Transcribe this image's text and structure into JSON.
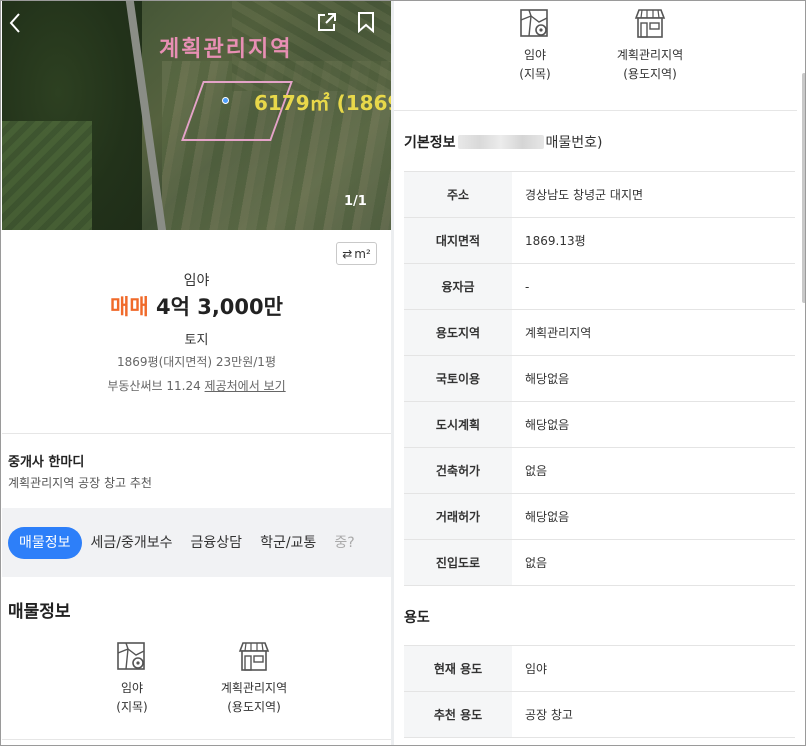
{
  "photo": {
    "zone_overlay": "계획관리지역",
    "area_overlay": "6179㎡ (1869",
    "counter": "1/1"
  },
  "summary": {
    "unit_toggle": "m²",
    "property_type": "임야",
    "deal_type": "매매",
    "price": "4억 3,000만",
    "category": "토지",
    "area_price": "1869평(대지면적)  23만원/1평",
    "source_prefix": "부동산써브 11.24",
    "source_link": "제공처에서 보기"
  },
  "broker": {
    "title": "중개사 한마디",
    "comment": "계획관리지역 공장 창고 추천"
  },
  "tabs": [
    {
      "label": "매물정보",
      "active": true
    },
    {
      "label": "세금/중개보수",
      "active": false
    },
    {
      "label": "금융상담",
      "active": false
    },
    {
      "label": "학군/교통",
      "active": false
    },
    {
      "label": "중?",
      "active": false
    }
  ],
  "listing_section": {
    "title": "매물정보",
    "land_icon": "map-pin-icon",
    "land_label": "임야",
    "land_sub": "(지목)",
    "zone_icon": "storefront-icon",
    "zone_label": "계획관리지역",
    "zone_sub": "(용도지역)"
  },
  "basic_info": {
    "title_prefix": "기본정보",
    "title_suffix": "매물번호)",
    "rows": [
      {
        "key": "주소",
        "value": "경상남도 창녕군 대지면"
      },
      {
        "key": "대지면적",
        "value": "1869.13평"
      },
      {
        "key": "융자금",
        "value": "-"
      },
      {
        "key": "용도지역",
        "value": "계획관리지역"
      },
      {
        "key": "국토이용",
        "value": "해당없음"
      },
      {
        "key": "도시계획",
        "value": "해당없음"
      },
      {
        "key": "건축허가",
        "value": "없음"
      },
      {
        "key": "거래허가",
        "value": "해당없음"
      },
      {
        "key": "진입도로",
        "value": "없음"
      }
    ]
  },
  "usage": {
    "title": "용도",
    "rows": [
      {
        "key": "현재 용도",
        "value": "임야"
      },
      {
        "key": "추천 용도",
        "value": "공장 창고"
      }
    ]
  },
  "colors": {
    "accent_blue": "#2d7ff9",
    "deal_orange": "#f06a2a",
    "zone_pink": "#e88fb4",
    "area_yellow": "#e8d84a"
  }
}
